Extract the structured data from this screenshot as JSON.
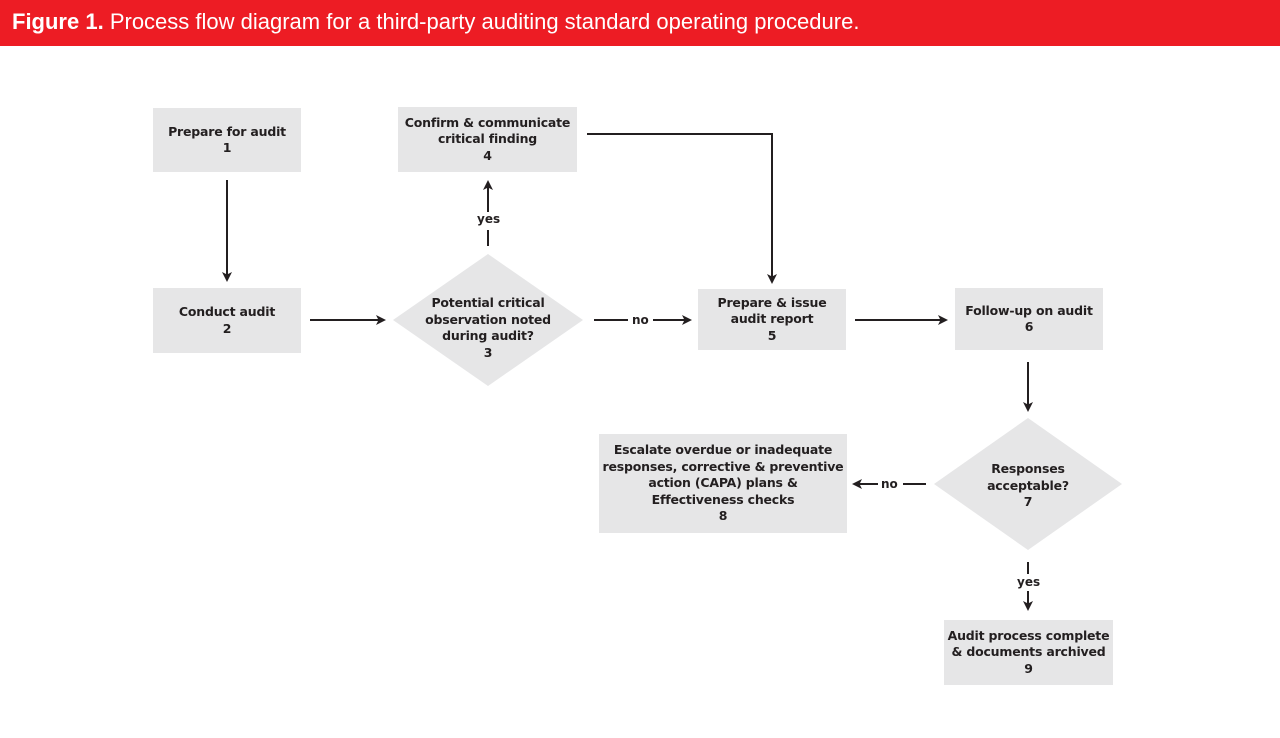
{
  "figure": {
    "label": "Figure 1.",
    "caption": "Process flow diagram for a third-party auditing standard operating procedure.",
    "colors": {
      "banner": "#ed1c24",
      "node_fill": "#e6e6e7",
      "line": "#231f20"
    }
  },
  "nodes": [
    {
      "id": "1",
      "type": "process",
      "lines": [
        "Prepare for audit"
      ],
      "number": "1"
    },
    {
      "id": "2",
      "type": "process",
      "lines": [
        "Conduct audit"
      ],
      "number": "2"
    },
    {
      "id": "3",
      "type": "decision",
      "lines": [
        "Potential critical",
        "observation noted",
        "during audit?"
      ],
      "number": "3"
    },
    {
      "id": "4",
      "type": "process",
      "lines": [
        "Confirm & communicate",
        "critical finding"
      ],
      "number": "4"
    },
    {
      "id": "5",
      "type": "process",
      "lines": [
        "Prepare & issue",
        "audit report"
      ],
      "number": "5"
    },
    {
      "id": "6",
      "type": "process",
      "lines": [
        "Follow-up on audit"
      ],
      "number": "6"
    },
    {
      "id": "7",
      "type": "decision",
      "lines": [
        "Responses",
        "acceptable?"
      ],
      "number": "7"
    },
    {
      "id": "8",
      "type": "process",
      "lines": [
        "Escalate overdue or inadequate",
        "responses, corrective & preventive",
        "action (CAPA) plans &",
        "Effectiveness checks"
      ],
      "number": "8"
    },
    {
      "id": "9",
      "type": "process",
      "lines": [
        "Audit process complete",
        "& documents archived"
      ],
      "number": "9"
    }
  ],
  "edges": [
    {
      "from": "1",
      "to": "2",
      "label": ""
    },
    {
      "from": "2",
      "to": "3",
      "label": ""
    },
    {
      "from": "3",
      "to": "4",
      "label": "yes"
    },
    {
      "from": "3",
      "to": "5",
      "label": "no"
    },
    {
      "from": "4",
      "to": "5",
      "label": ""
    },
    {
      "from": "5",
      "to": "6",
      "label": ""
    },
    {
      "from": "6",
      "to": "7",
      "label": ""
    },
    {
      "from": "7",
      "to": "8",
      "label": "no"
    },
    {
      "from": "7",
      "to": "9",
      "label": "yes"
    }
  ]
}
